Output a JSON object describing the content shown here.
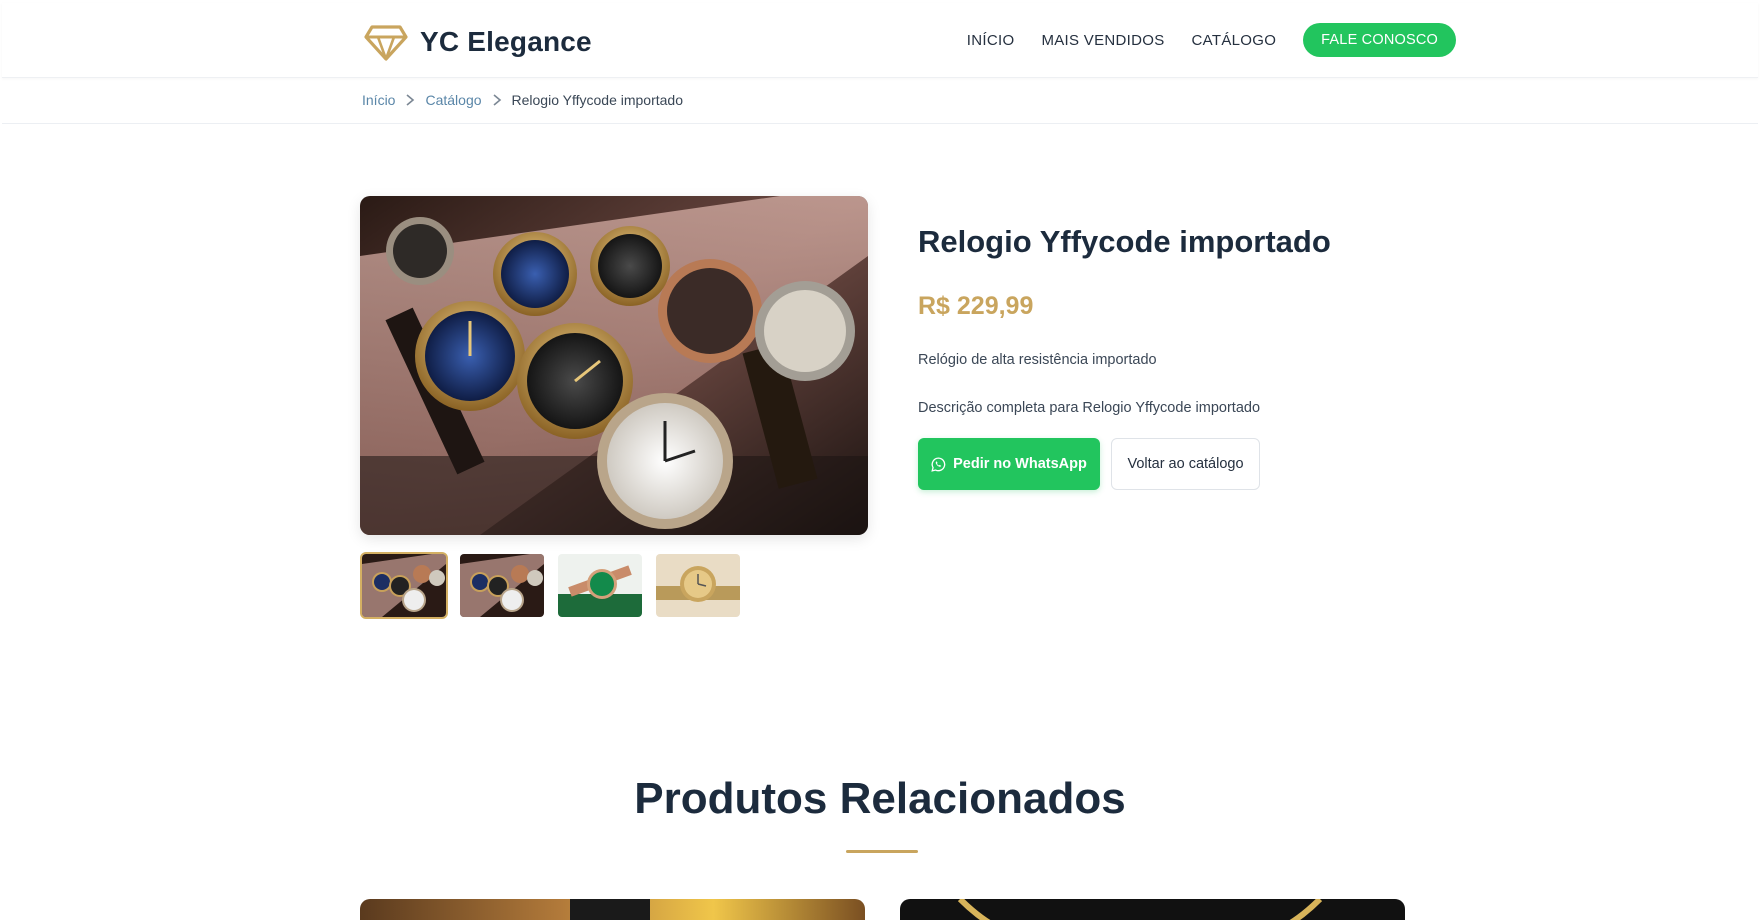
{
  "header": {
    "brand_name": "YC Elegance",
    "logo_icon": "diamond-icon",
    "nav": {
      "home": "INÍCIO",
      "best_sellers": "MAIS VENDIDOS",
      "catalog": "CATÁLOGO",
      "contact": "FALE CONOSCO"
    }
  },
  "breadcrumb": {
    "home": "Início",
    "catalog": "Catálogo",
    "current": "Relogio Yffycode importado"
  },
  "product": {
    "title": "Relogio Yffycode importado",
    "price": "R$ 229,99",
    "short_description": "Relógio de alta resistência importado",
    "full_description": "Descrição completa para Relogio Yffycode importado",
    "whatsapp_button": "Pedir no WhatsApp",
    "back_button": "Voltar ao catálogo",
    "thumbnails": [
      "watch-box",
      "watch-box",
      "green-dial-watch",
      "gold-watch"
    ]
  },
  "related": {
    "title": "Produtos Relacionados"
  },
  "colors": {
    "accent_gold": "#c9a55e",
    "whatsapp_green": "#22c55e",
    "heading": "#1c2b3d"
  }
}
